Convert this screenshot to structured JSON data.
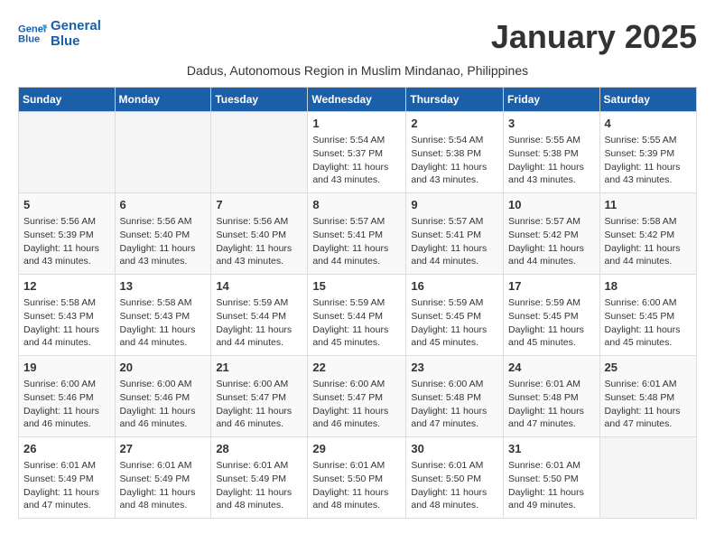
{
  "header": {
    "logo_line1": "General",
    "logo_line2": "Blue",
    "month_title": "January 2025",
    "subtitle": "Dadus, Autonomous Region in Muslim Mindanao, Philippines"
  },
  "weekdays": [
    "Sunday",
    "Monday",
    "Tuesday",
    "Wednesday",
    "Thursday",
    "Friday",
    "Saturday"
  ],
  "weeks": [
    [
      {
        "day": "",
        "info": ""
      },
      {
        "day": "",
        "info": ""
      },
      {
        "day": "",
        "info": ""
      },
      {
        "day": "1",
        "info": "Sunrise: 5:54 AM\nSunset: 5:37 PM\nDaylight: 11 hours\nand 43 minutes."
      },
      {
        "day": "2",
        "info": "Sunrise: 5:54 AM\nSunset: 5:38 PM\nDaylight: 11 hours\nand 43 minutes."
      },
      {
        "day": "3",
        "info": "Sunrise: 5:55 AM\nSunset: 5:38 PM\nDaylight: 11 hours\nand 43 minutes."
      },
      {
        "day": "4",
        "info": "Sunrise: 5:55 AM\nSunset: 5:39 PM\nDaylight: 11 hours\nand 43 minutes."
      }
    ],
    [
      {
        "day": "5",
        "info": "Sunrise: 5:56 AM\nSunset: 5:39 PM\nDaylight: 11 hours\nand 43 minutes."
      },
      {
        "day": "6",
        "info": "Sunrise: 5:56 AM\nSunset: 5:40 PM\nDaylight: 11 hours\nand 43 minutes."
      },
      {
        "day": "7",
        "info": "Sunrise: 5:56 AM\nSunset: 5:40 PM\nDaylight: 11 hours\nand 43 minutes."
      },
      {
        "day": "8",
        "info": "Sunrise: 5:57 AM\nSunset: 5:41 PM\nDaylight: 11 hours\nand 44 minutes."
      },
      {
        "day": "9",
        "info": "Sunrise: 5:57 AM\nSunset: 5:41 PM\nDaylight: 11 hours\nand 44 minutes."
      },
      {
        "day": "10",
        "info": "Sunrise: 5:57 AM\nSunset: 5:42 PM\nDaylight: 11 hours\nand 44 minutes."
      },
      {
        "day": "11",
        "info": "Sunrise: 5:58 AM\nSunset: 5:42 PM\nDaylight: 11 hours\nand 44 minutes."
      }
    ],
    [
      {
        "day": "12",
        "info": "Sunrise: 5:58 AM\nSunset: 5:43 PM\nDaylight: 11 hours\nand 44 minutes."
      },
      {
        "day": "13",
        "info": "Sunrise: 5:58 AM\nSunset: 5:43 PM\nDaylight: 11 hours\nand 44 minutes."
      },
      {
        "day": "14",
        "info": "Sunrise: 5:59 AM\nSunset: 5:44 PM\nDaylight: 11 hours\nand 44 minutes."
      },
      {
        "day": "15",
        "info": "Sunrise: 5:59 AM\nSunset: 5:44 PM\nDaylight: 11 hours\nand 45 minutes."
      },
      {
        "day": "16",
        "info": "Sunrise: 5:59 AM\nSunset: 5:45 PM\nDaylight: 11 hours\nand 45 minutes."
      },
      {
        "day": "17",
        "info": "Sunrise: 5:59 AM\nSunset: 5:45 PM\nDaylight: 11 hours\nand 45 minutes."
      },
      {
        "day": "18",
        "info": "Sunrise: 6:00 AM\nSunset: 5:45 PM\nDaylight: 11 hours\nand 45 minutes."
      }
    ],
    [
      {
        "day": "19",
        "info": "Sunrise: 6:00 AM\nSunset: 5:46 PM\nDaylight: 11 hours\nand 46 minutes."
      },
      {
        "day": "20",
        "info": "Sunrise: 6:00 AM\nSunset: 5:46 PM\nDaylight: 11 hours\nand 46 minutes."
      },
      {
        "day": "21",
        "info": "Sunrise: 6:00 AM\nSunset: 5:47 PM\nDaylight: 11 hours\nand 46 minutes."
      },
      {
        "day": "22",
        "info": "Sunrise: 6:00 AM\nSunset: 5:47 PM\nDaylight: 11 hours\nand 46 minutes."
      },
      {
        "day": "23",
        "info": "Sunrise: 6:00 AM\nSunset: 5:48 PM\nDaylight: 11 hours\nand 47 minutes."
      },
      {
        "day": "24",
        "info": "Sunrise: 6:01 AM\nSunset: 5:48 PM\nDaylight: 11 hours\nand 47 minutes."
      },
      {
        "day": "25",
        "info": "Sunrise: 6:01 AM\nSunset: 5:48 PM\nDaylight: 11 hours\nand 47 minutes."
      }
    ],
    [
      {
        "day": "26",
        "info": "Sunrise: 6:01 AM\nSunset: 5:49 PM\nDaylight: 11 hours\nand 47 minutes."
      },
      {
        "day": "27",
        "info": "Sunrise: 6:01 AM\nSunset: 5:49 PM\nDaylight: 11 hours\nand 48 minutes."
      },
      {
        "day": "28",
        "info": "Sunrise: 6:01 AM\nSunset: 5:49 PM\nDaylight: 11 hours\nand 48 minutes."
      },
      {
        "day": "29",
        "info": "Sunrise: 6:01 AM\nSunset: 5:50 PM\nDaylight: 11 hours\nand 48 minutes."
      },
      {
        "day": "30",
        "info": "Sunrise: 6:01 AM\nSunset: 5:50 PM\nDaylight: 11 hours\nand 48 minutes."
      },
      {
        "day": "31",
        "info": "Sunrise: 6:01 AM\nSunset: 5:50 PM\nDaylight: 11 hours\nand 49 minutes."
      },
      {
        "day": "",
        "info": ""
      }
    ]
  ]
}
